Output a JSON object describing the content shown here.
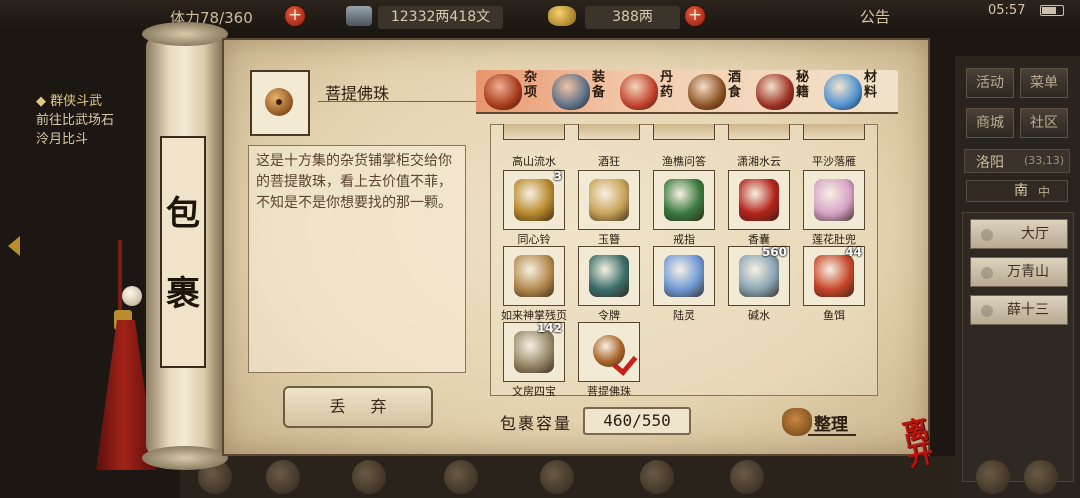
{
  "topbar": {
    "stamina": "体力78/360",
    "money": "12332两418文",
    "gold": "388两",
    "notice": "公告",
    "time": "05:57"
  },
  "quest": {
    "title": "群侠斗武",
    "line1": "前往比武场石",
    "line2": "泠月比斗"
  },
  "right_menu": {
    "activity": "活动",
    "menu": "菜单",
    "shop": "商城",
    "community": "社区",
    "location": "洛阳",
    "coords": "(33,13)",
    "compass_mark": "南",
    "compass_mid": "中",
    "npcs": [
      "大厅",
      "万青山",
      "薛十三"
    ]
  },
  "scroll": {
    "title_chars": [
      "包",
      "裹"
    ]
  },
  "selected_item": {
    "name": "菩提佛珠",
    "description": "这是十方集的杂货铺掌柜交给你的菩提散珠，看上去价值不菲，不知是不是你想要找的那一颗。"
  },
  "discard_label": "丢 弃",
  "categories": [
    {
      "label": "杂项",
      "icon": "jar-icon",
      "color": "#a63a1b"
    },
    {
      "label": "装备",
      "icon": "armor-icon",
      "color": "#5a6f86"
    },
    {
      "label": "丹药",
      "icon": "pills-icon",
      "color": "#c0402a"
    },
    {
      "label": "酒食",
      "icon": "wine-icon",
      "color": "#8a5122"
    },
    {
      "label": "秘籍",
      "icon": "book-icon",
      "color": "#9b2f22"
    },
    {
      "label": "材料",
      "icon": "crystal-icon",
      "color": "#4b8fd0"
    }
  ],
  "partial_row": [
    "高山流水",
    "酒狂",
    "渔樵问答",
    "潇湘水云",
    "平沙落雁"
  ],
  "items": [
    {
      "name": "同心铃",
      "count": "3",
      "icon": "bell-icon",
      "color": "#b98a2e"
    },
    {
      "name": "玉簪",
      "count": "",
      "icon": "hairpin-icon",
      "color": "#c9a45a"
    },
    {
      "name": "戒指",
      "count": "",
      "icon": "ring-icon",
      "color": "#3b7a3f"
    },
    {
      "name": "香囊",
      "count": "",
      "icon": "sachet-icon",
      "color": "#b3241c"
    },
    {
      "name": "莲花肚兜",
      "count": "",
      "icon": "bodice-icon",
      "color": "#d6a3c7"
    },
    {
      "name": "如来神掌残页",
      "count": "",
      "icon": "scrap-icon",
      "color": "#b58a4f"
    },
    {
      "name": "令牌",
      "count": "",
      "icon": "token-icon",
      "color": "#3b6f6a"
    },
    {
      "name": "陆灵",
      "count": "",
      "icon": "blades-icon",
      "color": "#6f9ad6"
    },
    {
      "name": "碱水",
      "count": "560",
      "icon": "bowl-icon",
      "color": "#8aa5b4"
    },
    {
      "name": "鱼饵",
      "count": "44",
      "icon": "worm-icon",
      "color": "#c7472b"
    },
    {
      "name": "文房四宝",
      "count": "142",
      "icon": "brush-icon",
      "color": "#9a8a6a"
    },
    {
      "name": "菩提佛珠",
      "count": "",
      "icon": "bead-icon",
      "color": "#a9652a"
    }
  ],
  "capacity": {
    "label": "包裹容量",
    "value": "460/550"
  },
  "sort_label": "整理",
  "leave_label": "离开"
}
